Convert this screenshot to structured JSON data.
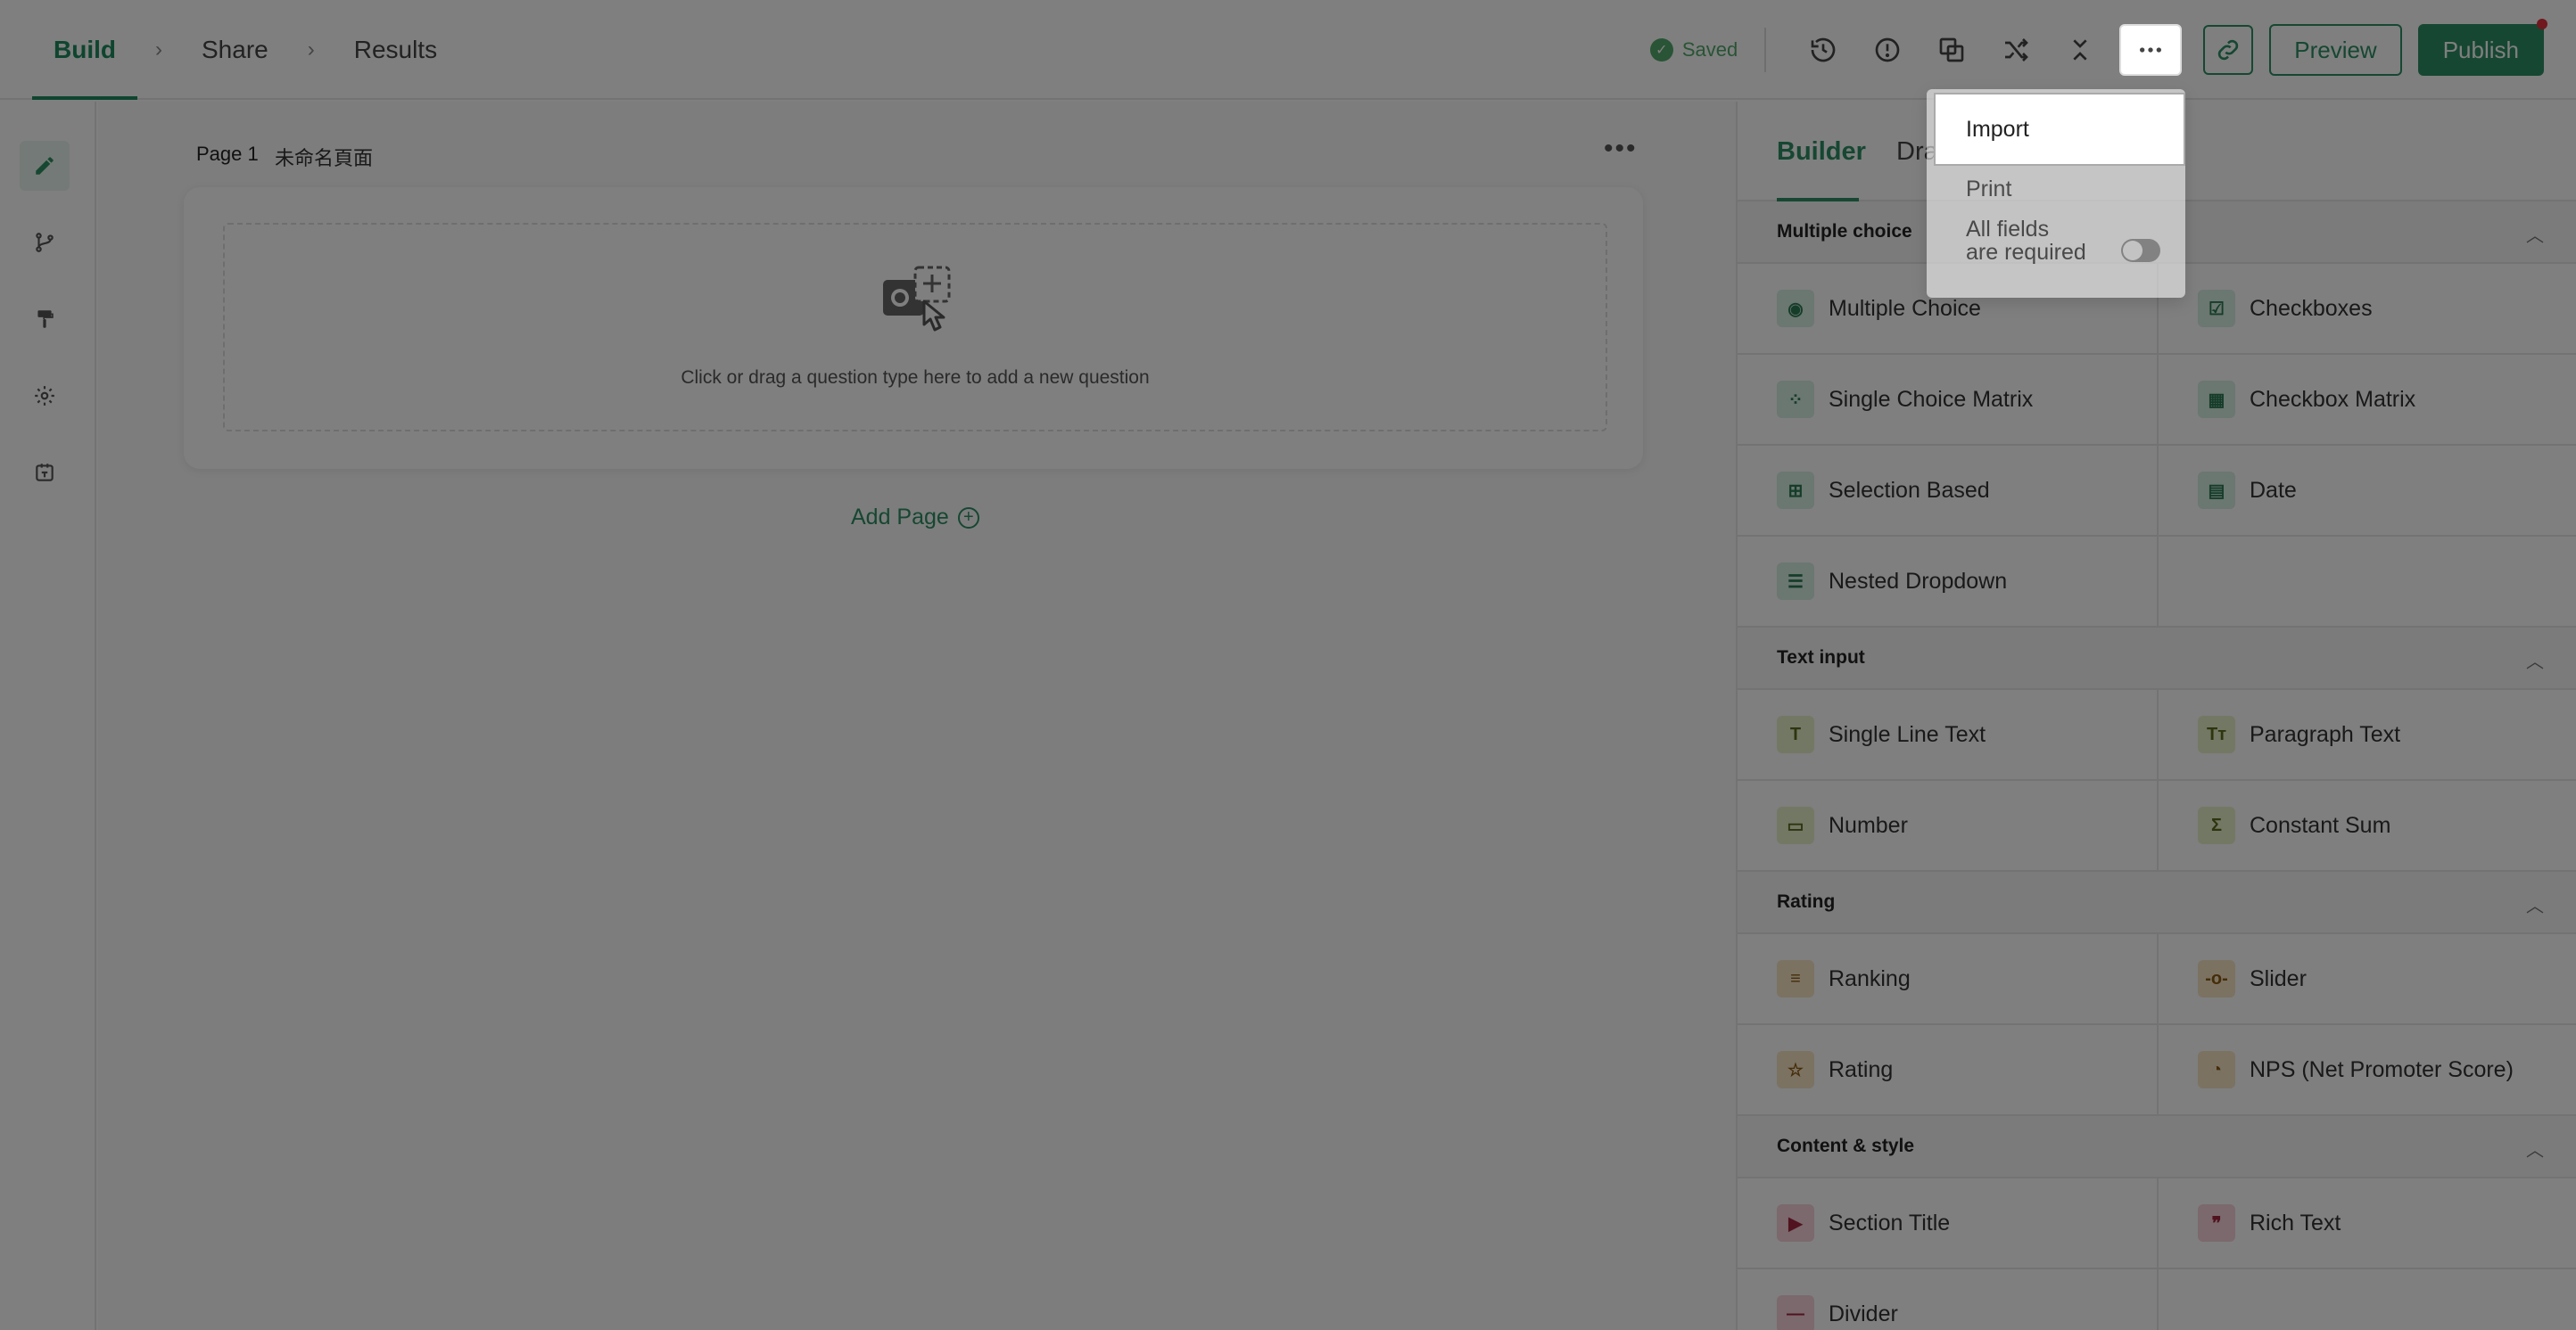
{
  "breadcrumbs": [
    {
      "label": "Build"
    },
    {
      "label": "Share"
    },
    {
      "label": "Results"
    }
  ],
  "topbar": {
    "saved_label": "Saved",
    "preview_label": "Preview",
    "publish_label": "Publish"
  },
  "icons": {
    "history": "history-icon",
    "info": "alert-circle-icon",
    "copy": "duplicate-icon",
    "shuffle": "shuffle-icon",
    "collapse": "collapse-icon",
    "more": "more-horizontal-icon",
    "link": "link-icon"
  },
  "canvas": {
    "page_label": "Page 1",
    "page_name": "未命名頁面",
    "dropzone_text": "Click or drag a question type here to add a new question",
    "add_page_label": "Add Page"
  },
  "panel": {
    "tabs": [
      {
        "label": "Builder"
      },
      {
        "label": "Dra"
      }
    ],
    "sections": [
      {
        "title": "Multiple choice",
        "items": [
          {
            "label": "Multiple Choice",
            "icon": "radio-icon"
          },
          {
            "label": "Checkboxes",
            "icon": "checkbox-icon"
          },
          {
            "label": "Single Choice Matrix",
            "icon": "matrix-icon"
          },
          {
            "label": "Checkbox Matrix",
            "icon": "grid-icon"
          },
          {
            "label": "Selection Based",
            "icon": "selection-icon"
          },
          {
            "label": "Date",
            "icon": "calendar-icon"
          },
          {
            "label": "Nested Dropdown",
            "icon": "nested-dropdown-icon"
          }
        ]
      },
      {
        "title": "Text input",
        "items": [
          {
            "label": "Single Line Text",
            "icon": "text-t-icon"
          },
          {
            "label": "Paragraph Text",
            "icon": "paragraph-icon"
          },
          {
            "label": "Number",
            "icon": "number-icon"
          },
          {
            "label": "Constant Sum",
            "icon": "sigma-icon"
          }
        ]
      },
      {
        "title": "Rating",
        "items": [
          {
            "label": "Ranking",
            "icon": "ranking-icon"
          },
          {
            "label": "Slider",
            "icon": "slider-icon"
          },
          {
            "label": "Rating",
            "icon": "star-icon"
          },
          {
            "label": "NPS (Net Promoter Score)",
            "icon": "nps-icon"
          }
        ]
      },
      {
        "title": "Content & style",
        "items": [
          {
            "label": "Section Title",
            "icon": "section-title-icon"
          },
          {
            "label": "Rich Text",
            "icon": "quote-icon"
          },
          {
            "label": "Divider",
            "icon": "divider-icon"
          }
        ]
      }
    ]
  },
  "menu": {
    "items": [
      {
        "label": "Import"
      },
      {
        "label": "Print"
      }
    ],
    "toggle_label_line1": "All fields",
    "toggle_label_line2": "are required"
  }
}
